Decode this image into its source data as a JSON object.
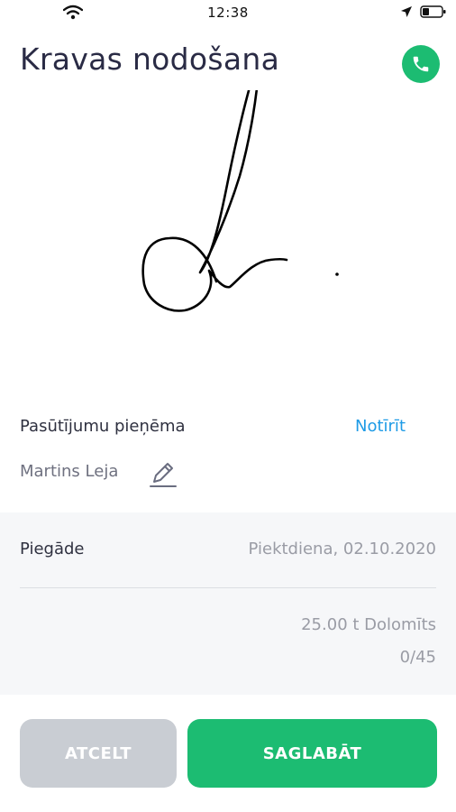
{
  "status_bar": {
    "time": "12:38"
  },
  "header": {
    "title": "Kravas nodošana"
  },
  "signature": {
    "received_label": "Pasūtījumu pieņēma",
    "clear_label": "Notīrīt",
    "signer_name": "Martins Leja"
  },
  "delivery": {
    "label": "Piegāde",
    "date": "Piektdiena, 02.10.2020",
    "cargo": "25.00 t Dolomīts",
    "count": "0/45"
  },
  "actions": {
    "cancel_label": "ATCELT",
    "save_label": "SAGLABĀT"
  },
  "colors": {
    "accent_green": "#1cbc72",
    "link_blue": "#1e9be6",
    "cancel_gray": "#c9cdd3"
  }
}
